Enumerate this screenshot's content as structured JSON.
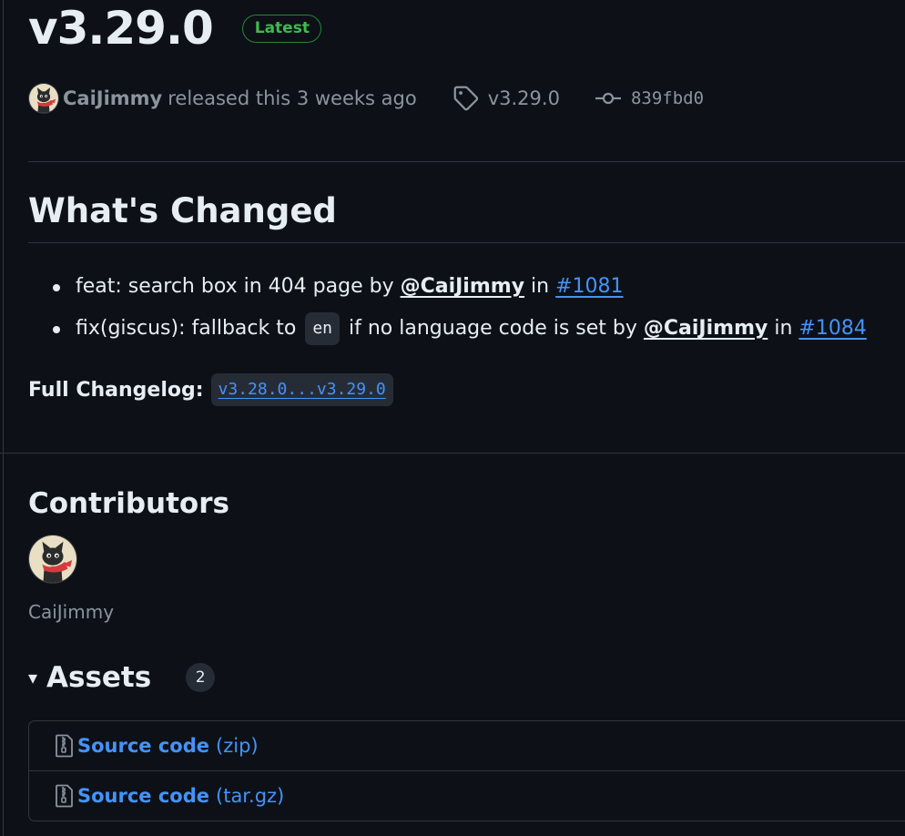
{
  "release": {
    "title": "v3.29.0",
    "badge": "Latest",
    "author": "CaiJimmy",
    "released_text": "released this 3 weeks ago",
    "tag": "v3.29.0",
    "commit": "839fbd0"
  },
  "notes": {
    "heading": "What's Changed",
    "items": [
      {
        "text": "feat: search box in 404 page by",
        "mention": "@CaiJimmy",
        "in": "in",
        "pr": "#1081"
      },
      {
        "text_before": "fix(giscus): fallback to",
        "code": "en",
        "text_after": "if no language code is set by",
        "mention": "@CaiJimmy",
        "in": "in",
        "pr": "#1084"
      }
    ],
    "changelog_label": "Full Changelog:",
    "changelog_link": "v3.28.0...v3.29.0"
  },
  "contributors": {
    "heading": "Contributors",
    "names": [
      "CaiJimmy"
    ]
  },
  "assets": {
    "heading": "Assets",
    "count": "2",
    "items": [
      {
        "name": "Source code",
        "ext": "(zip)"
      },
      {
        "name": "Source code",
        "ext": "(tar.gz)"
      }
    ]
  },
  "colors": {
    "background": "#0d1117",
    "text": "#e6edf3",
    "muted": "#8b949e",
    "link": "#4493f8",
    "success": "#3fb950",
    "border": "#30363d"
  },
  "icons": [
    "avatar-cat",
    "tag-icon",
    "git-commit-icon",
    "triangle-down-icon",
    "file-zip-icon"
  ]
}
